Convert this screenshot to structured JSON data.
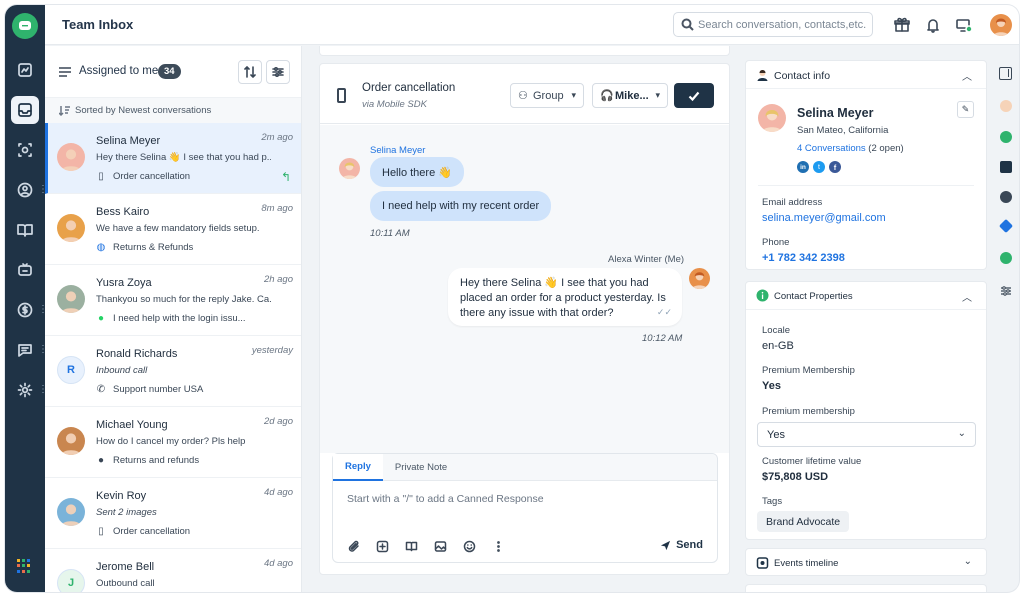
{
  "header": {
    "title": "Team Inbox",
    "search_placeholder": "Search conversation, contacts,etc."
  },
  "list": {
    "filter_label": "Assigned to me",
    "count": "34",
    "sort_label": "Sorted by Newest conversations",
    "items": [
      {
        "name": "Selina Meyer",
        "time": "2m ago",
        "message": "Hey there Selina 👋 I see that you had p...",
        "meta": "Order cancellation",
        "meta_icon": "mobile-icon",
        "italic": false,
        "selected": true,
        "avatar_color": "#f3b5a7",
        "initial": ""
      },
      {
        "name": "Bess Kairo",
        "time": "8m ago",
        "message": "We have a few mandatory fields setup.",
        "meta": "Returns & Refunds",
        "meta_icon": "globe-icon",
        "italic": false,
        "selected": false,
        "avatar_color": "#e8a14a",
        "initial": ""
      },
      {
        "name": "Yusra Zoya",
        "time": "2h ago",
        "message": "Thankyou so much for the reply Jake. Ca...",
        "meta": "I need help with the login issu...",
        "meta_icon": "whatsapp-icon",
        "italic": false,
        "selected": false,
        "avatar_color": "#9bb0a0",
        "initial": ""
      },
      {
        "name": "Ronald Richards",
        "time": "yesterday",
        "message": "Inbound call",
        "meta": "Support number USA",
        "meta_icon": "phone-icon",
        "italic": true,
        "selected": false,
        "avatar_color": "#e8f1fd",
        "initial": "R"
      },
      {
        "name": "Michael Young",
        "time": "2d ago",
        "message": "How do I cancel my order? Pls help",
        "meta": "Returns and refunds",
        "meta_icon": "apple-icon",
        "italic": false,
        "selected": false,
        "avatar_color": "#c9864f",
        "initial": ""
      },
      {
        "name": "Kevin Roy",
        "time": "4d ago",
        "message": "Sent 2 images",
        "meta": "Order cancellation",
        "meta_icon": "mobile-icon",
        "italic": true,
        "selected": false,
        "avatar_color": "#7ab3d9",
        "initial": ""
      },
      {
        "name": "Jerome Bell",
        "time": "4d ago",
        "message": "Outbound call",
        "meta": "",
        "meta_icon": "",
        "italic": false,
        "selected": false,
        "avatar_color": "#e6f6ec",
        "initial": "J"
      }
    ]
  },
  "chat": {
    "title": "Order cancellation",
    "subtitle": "via Mobile SDK",
    "group_label": "Group",
    "agent_label": "Mike...",
    "sender_name": "Selina Meyer",
    "in_messages": [
      "Hello there 👋",
      "I need help with my recent order"
    ],
    "in_time": "10:11 AM",
    "agent_name": "Alexa Winter (Me)",
    "out_message": "Hey there Selina 👋 I see that you had placed an order for a product yesterday. Is there any issue with that order?",
    "out_time": "10:12 AM",
    "tabs": [
      "Reply",
      "Private Note"
    ],
    "reply_placeholder": "Start with a \"/\" to add a Canned Response",
    "send_label": "Send"
  },
  "contact": {
    "section_title": "Contact info",
    "name": "Selina Meyer",
    "location": "San Mateo, California",
    "conversations_link": "4 Conversations",
    "conversations_open": "(2 open)",
    "email_label": "Email address",
    "email": "selina.meyer@gmail.com",
    "phone_label": "Phone",
    "phone": "+1 782 342 2398"
  },
  "properties": {
    "section_title": "Contact Properties",
    "locale_label": "Locale",
    "locale": "en-GB",
    "premium_label": "Premium Membership",
    "premium": "Yes",
    "premium2_label": "Premium membership",
    "premium2_select": "Yes",
    "ltv_label": "Customer lifetime value",
    "ltv": "$75,808 USD",
    "tags_label": "Tags",
    "tag": "Brand Advocate"
  },
  "events": {
    "section_title": "Events timeline"
  },
  "colors": {
    "rail": "#1f3346",
    "accent": "#1f73e0",
    "brand_green": "#2fb36d"
  }
}
